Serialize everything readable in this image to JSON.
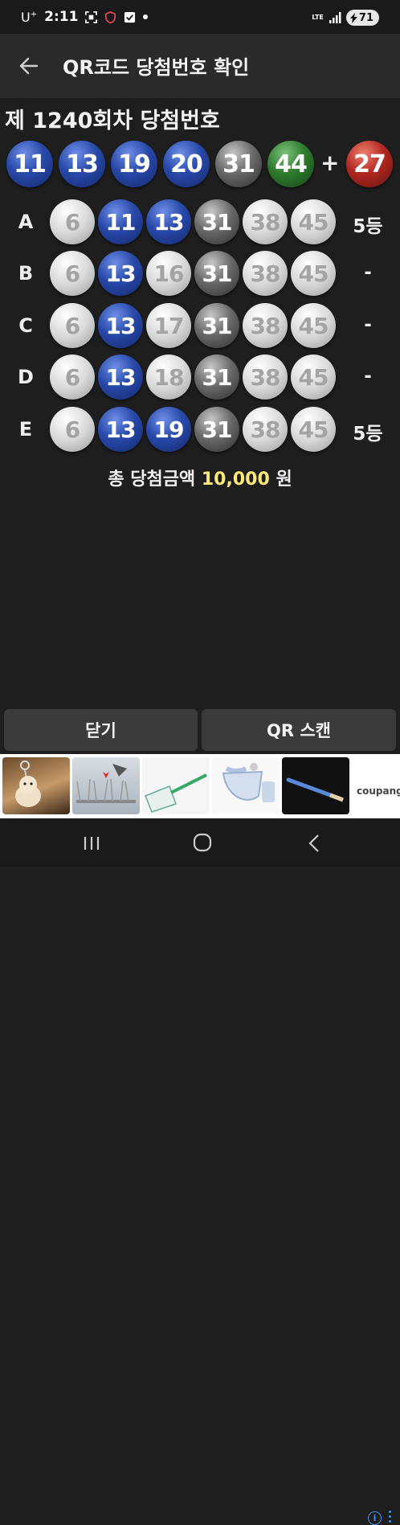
{
  "status_bar": {
    "carrier": "U",
    "carrier_sup": "+",
    "time": "2:11",
    "network": "LTE",
    "battery": "71"
  },
  "app_bar": {
    "title": "QR코드 당첨번호 확인"
  },
  "round_title": "제 1240회차 당첨번호",
  "winning_numbers": [
    {
      "num": "11",
      "color": "blue"
    },
    {
      "num": "13",
      "color": "blue"
    },
    {
      "num": "19",
      "color": "blue"
    },
    {
      "num": "20",
      "color": "blue"
    },
    {
      "num": "31",
      "color": "gray"
    },
    {
      "num": "44",
      "color": "green"
    }
  ],
  "plus_sign": "+",
  "bonus_number": {
    "num": "27",
    "color": "red"
  },
  "tickets": [
    {
      "letter": "A",
      "result": "5등",
      "balls": [
        {
          "num": "6",
          "style": "light"
        },
        {
          "num": "11",
          "style": "blue"
        },
        {
          "num": "13",
          "style": "blue"
        },
        {
          "num": "31",
          "style": "gray"
        },
        {
          "num": "38",
          "style": "light"
        },
        {
          "num": "45",
          "style": "light"
        }
      ]
    },
    {
      "letter": "B",
      "result": "-",
      "balls": [
        {
          "num": "6",
          "style": "light"
        },
        {
          "num": "13",
          "style": "blue"
        },
        {
          "num": "16",
          "style": "light"
        },
        {
          "num": "31",
          "style": "gray"
        },
        {
          "num": "38",
          "style": "light"
        },
        {
          "num": "45",
          "style": "light"
        }
      ]
    },
    {
      "letter": "C",
      "result": "-",
      "balls": [
        {
          "num": "6",
          "style": "light"
        },
        {
          "num": "13",
          "style": "blue"
        },
        {
          "num": "17",
          "style": "light"
        },
        {
          "num": "31",
          "style": "gray"
        },
        {
          "num": "38",
          "style": "light"
        },
        {
          "num": "45",
          "style": "light"
        }
      ]
    },
    {
      "letter": "D",
      "result": "-",
      "balls": [
        {
          "num": "6",
          "style": "light"
        },
        {
          "num": "13",
          "style": "blue"
        },
        {
          "num": "18",
          "style": "light"
        },
        {
          "num": "31",
          "style": "gray"
        },
        {
          "num": "38",
          "style": "light"
        },
        {
          "num": "45",
          "style": "light"
        }
      ]
    },
    {
      "letter": "E",
      "result": "5등",
      "balls": [
        {
          "num": "6",
          "style": "light"
        },
        {
          "num": "13",
          "style": "blue"
        },
        {
          "num": "19",
          "style": "blue"
        },
        {
          "num": "31",
          "style": "gray"
        },
        {
          "num": "38",
          "style": "light"
        },
        {
          "num": "45",
          "style": "light"
        }
      ]
    }
  ],
  "total": {
    "prefix": "총 당첨금액",
    "amount": "10,000",
    "unit": "원"
  },
  "buttons": {
    "close": "닫기",
    "qr_scan": "QR 스캔"
  },
  "ad": {
    "brand": "coupang",
    "info_icon": "i"
  },
  "colors": {
    "blue": "#2848a8",
    "gray": "#6a6a6a",
    "green": "#2f7a2f",
    "red": "#b02820",
    "light": "#d8d8d8",
    "amount": "#ffe87a"
  }
}
